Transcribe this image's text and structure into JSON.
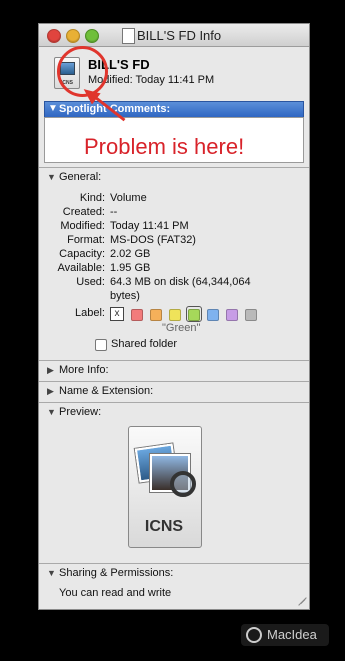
{
  "window": {
    "title": "BILL'S FD Info",
    "doc_icon_label": "▫"
  },
  "header": {
    "file_name": "BILL'S FD",
    "modified": "Modified: Today 11:41 PM",
    "icon_label": "ICNS"
  },
  "spotlight": {
    "label": "Spotlight Comments:",
    "annotation": "Problem is here!"
  },
  "general": {
    "title": "General:",
    "rows": [
      {
        "key": "Kind:",
        "value": "Volume"
      },
      {
        "key": "Created:",
        "value": "--"
      },
      {
        "key": "Modified:",
        "value": "Today 11:41 PM"
      },
      {
        "key": "Format:",
        "value": "MS-DOS (FAT32)"
      },
      {
        "key": "Capacity:",
        "value": "2.02 GB"
      },
      {
        "key": "Available:",
        "value": "1.95 GB"
      },
      {
        "key": "Used:",
        "value": "64.3 MB on disk (64,344,064"
      }
    ],
    "used_cont": "bytes)",
    "label_key": "Label:",
    "label_none": "x",
    "label_selected": "\"Green\"",
    "label_colors": [
      "#f27b7b",
      "#f5b05a",
      "#efe35a",
      "#a6d85a",
      "#7fb2ef",
      "#c79de6",
      "#b9b9b9"
    ],
    "shared_folder": "Shared folder"
  },
  "sections": {
    "more_info": "More Info:",
    "name_ext": "Name & Extension:",
    "preview": "Preview:",
    "sharing": "Sharing & Permissions:"
  },
  "preview": {
    "icon_label": "ICNS"
  },
  "permissions": {
    "text": "You can read and write"
  },
  "watermark": {
    "text": "MacIdea"
  },
  "colors": {
    "annotation": "#d8232a",
    "selection": "#2f66c2"
  }
}
